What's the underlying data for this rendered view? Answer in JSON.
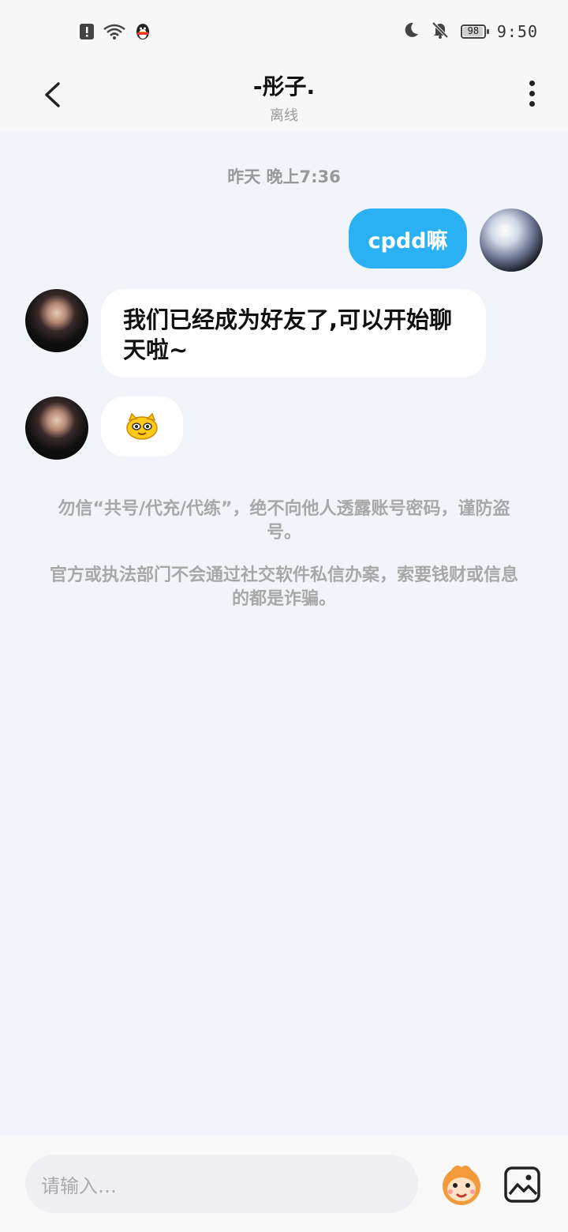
{
  "status_bar": {
    "time": "9:50",
    "battery": "98",
    "battery_percent": 98,
    "left_icons": [
      "alert-icon",
      "wifi-icon",
      "qq-penguin-icon"
    ],
    "right_icons": [
      "moon-icon",
      "bell-off-icon",
      "battery-icon"
    ]
  },
  "header": {
    "title": "-彤子.",
    "subtitle": "离线"
  },
  "chat": {
    "timestamp": "昨天 晚上7:36",
    "messages": [
      {
        "from": "self",
        "text": "cpdd嘛"
      },
      {
        "from": "other",
        "text": "我们已经成为好友了,可以开始聊天啦~"
      },
      {
        "from": "other",
        "type": "sticker",
        "sticker": "yellow-cat-face-sticker"
      }
    ],
    "notice_1": "勿信“共号/代充/代练”，绝不向他人透露账号密码，谨防盗号。",
    "notice_2": "官方或执法部门不会通过社交软件私信办案，索要钱财或信息的都是诈骗。"
  },
  "input": {
    "placeholder": "请输入…"
  },
  "colors": {
    "accent_blue": "#2ab1f3",
    "chat_bg": "#f1f4f8",
    "bubble_white": "#ffffff",
    "notice_gray": "#a8a8a8"
  }
}
